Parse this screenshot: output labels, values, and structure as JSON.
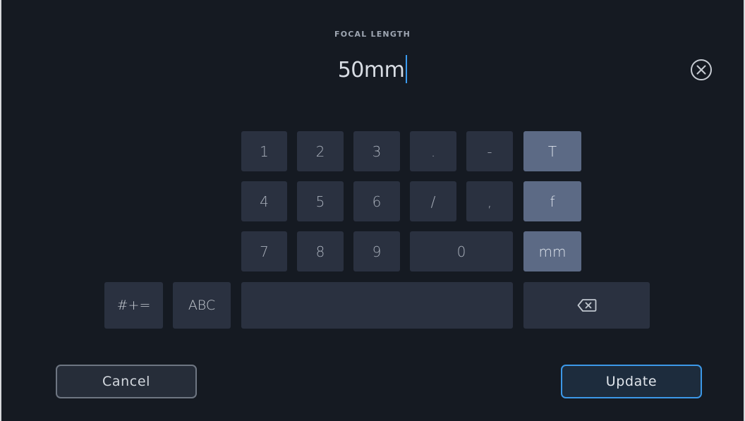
{
  "field": {
    "label": "FOCAL LENGTH",
    "value": "50mm"
  },
  "icons": {
    "close": "close-circle-icon",
    "backspace": "backspace-icon"
  },
  "keypad": {
    "k1": "1",
    "k2": "2",
    "k3": "3",
    "dot": ".",
    "dash": "-",
    "t": "T",
    "k4": "4",
    "k5": "5",
    "k6": "6",
    "slash": "/",
    "comma": ",",
    "f": "f",
    "k7": "7",
    "k8": "8",
    "k9": "9",
    "k0": "0",
    "mm": "mm",
    "symbols": "#+=",
    "abc": "ABC"
  },
  "actions": {
    "cancel": "Cancel",
    "update": "Update"
  },
  "colors": {
    "background": "#151a22",
    "key": "#2a3140",
    "unit_key": "#5c6a85",
    "accent": "#3c98e8"
  }
}
